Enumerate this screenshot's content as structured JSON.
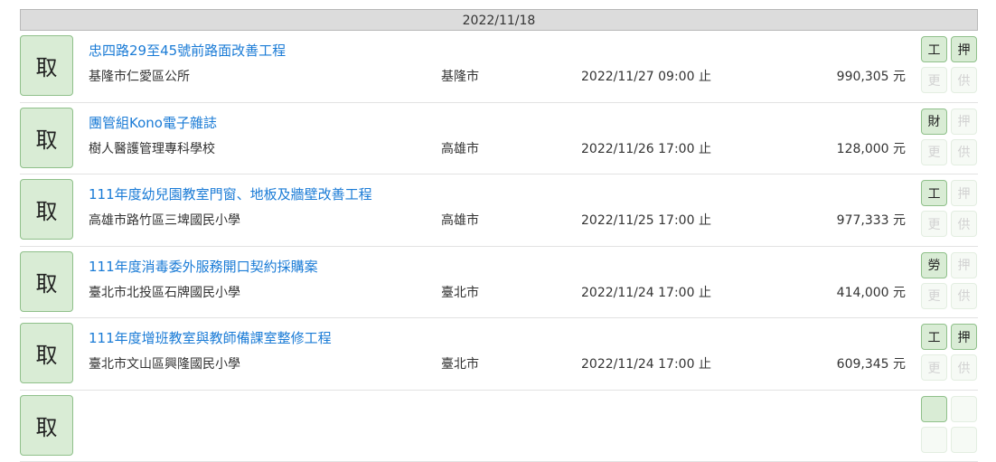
{
  "date_header": "2022/11/18",
  "rows": [
    {
      "take": "取",
      "title": "忠四路29至45號前路面改善工程",
      "org": "基隆市仁愛區公所",
      "city": "基隆市",
      "deadline": "2022/11/27 09:00 止",
      "amount": "990,305 元",
      "tags": [
        {
          "label": "工",
          "active": true
        },
        {
          "label": "押",
          "active": true
        },
        {
          "label": "更",
          "active": false
        },
        {
          "label": "供",
          "active": false
        }
      ]
    },
    {
      "take": "取",
      "title": "團管組Kono電子雜誌",
      "org": "樹人醫護管理專科學校",
      "city": "高雄市",
      "deadline": "2022/11/26 17:00 止",
      "amount": "128,000 元",
      "tags": [
        {
          "label": "財",
          "active": true
        },
        {
          "label": "押",
          "active": false
        },
        {
          "label": "更",
          "active": false
        },
        {
          "label": "供",
          "active": false
        }
      ]
    },
    {
      "take": "取",
      "title": "111年度幼兒園教室門窗、地板及牆壁改善工程",
      "org": "高雄市路竹區三埤國民小學",
      "city": "高雄市",
      "deadline": "2022/11/25 17:00 止",
      "amount": "977,333 元",
      "tags": [
        {
          "label": "工",
          "active": true
        },
        {
          "label": "押",
          "active": false
        },
        {
          "label": "更",
          "active": false
        },
        {
          "label": "供",
          "active": false
        }
      ]
    },
    {
      "take": "取",
      "title": "111年度消毒委外服務開口契約採購案",
      "org": "臺北市北投區石牌國民小學",
      "city": "臺北市",
      "deadline": "2022/11/24 17:00 止",
      "amount": "414,000 元",
      "tags": [
        {
          "label": "勞",
          "active": true
        },
        {
          "label": "押",
          "active": false
        },
        {
          "label": "更",
          "active": false
        },
        {
          "label": "供",
          "active": false
        }
      ]
    },
    {
      "take": "取",
      "title": "111年度增班教室與教師備課室整修工程",
      "org": "臺北市文山區興隆國民小學",
      "city": "臺北市",
      "deadline": "2022/11/24 17:00 止",
      "amount": "609,345 元",
      "tags": [
        {
          "label": "工",
          "active": true
        },
        {
          "label": "押",
          "active": true
        },
        {
          "label": "更",
          "active": false
        },
        {
          "label": "供",
          "active": false
        }
      ]
    },
    {
      "take": "取",
      "title": "",
      "org": "",
      "city": "",
      "deadline": "",
      "amount": "",
      "tags": [
        {
          "label": "",
          "active": true
        },
        {
          "label": "",
          "active": false
        },
        {
          "label": "",
          "active": false
        },
        {
          "label": "",
          "active": false
        }
      ]
    }
  ]
}
